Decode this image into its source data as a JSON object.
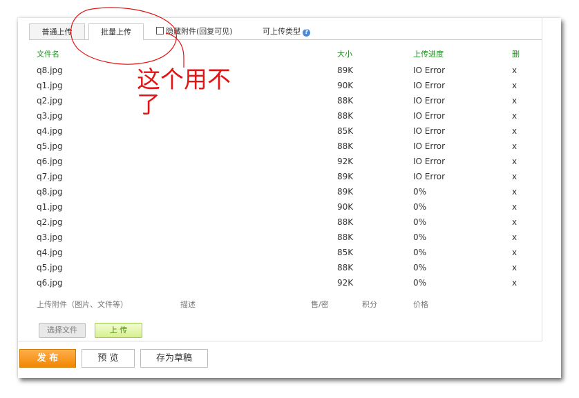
{
  "tabs": [
    {
      "label": "普通上传"
    },
    {
      "label": "批量上传"
    },
    {
      "label": "隐藏附件(回复可见)"
    },
    {
      "label": "可上传类型"
    }
  ],
  "help_icon": "question-circle-icon",
  "table": {
    "headers": {
      "name": "文件名",
      "size": "大小",
      "progress": "上传进度",
      "delete": "删"
    },
    "rows": [
      {
        "name": "q8.jpg",
        "size": "89K",
        "progress": "IO Error",
        "delete": "x"
      },
      {
        "name": "q1.jpg",
        "size": "90K",
        "progress": "IO Error",
        "delete": "x"
      },
      {
        "name": "q2.jpg",
        "size": "88K",
        "progress": "IO Error",
        "delete": "x"
      },
      {
        "name": "q3.jpg",
        "size": "88K",
        "progress": "IO Error",
        "delete": "x"
      },
      {
        "name": "q4.jpg",
        "size": "85K",
        "progress": "IO Error",
        "delete": "x"
      },
      {
        "name": "q5.jpg",
        "size": "88K",
        "progress": "IO Error",
        "delete": "x"
      },
      {
        "name": "q6.jpg",
        "size": "92K",
        "progress": "IO Error",
        "delete": "x"
      },
      {
        "name": "q7.jpg",
        "size": "89K",
        "progress": "IO Error",
        "delete": "x"
      },
      {
        "name": "q8.jpg",
        "size": "89K",
        "progress": "0%",
        "delete": "x"
      },
      {
        "name": "q1.jpg",
        "size": "90K",
        "progress": "0%",
        "delete": "x"
      },
      {
        "name": "q2.jpg",
        "size": "88K",
        "progress": "0%",
        "delete": "x"
      },
      {
        "name": "q3.jpg",
        "size": "88K",
        "progress": "0%",
        "delete": "x"
      },
      {
        "name": "q4.jpg",
        "size": "85K",
        "progress": "0%",
        "delete": "x"
      },
      {
        "name": "q5.jpg",
        "size": "88K",
        "progress": "0%",
        "delete": "x"
      },
      {
        "name": "q6.jpg",
        "size": "92K",
        "progress": "0%",
        "delete": "x"
      }
    ]
  },
  "footer_labels": {
    "attachment": "上传附件（图片、文件等）",
    "description": "描述",
    "sale": "售/密",
    "points": "积分",
    "price": "价格"
  },
  "buttons": {
    "choose_file": "选择文件",
    "upload": "上 传",
    "publish": "发 布",
    "preview": "预 览",
    "save_draft": "存为草稿"
  },
  "annotation": {
    "text": "这个用不了",
    "color": "#e21414"
  },
  "colors": {
    "header_green": "#1f8f1f",
    "publish_orange": "#f18600",
    "upload_green": "#d6f08d"
  }
}
